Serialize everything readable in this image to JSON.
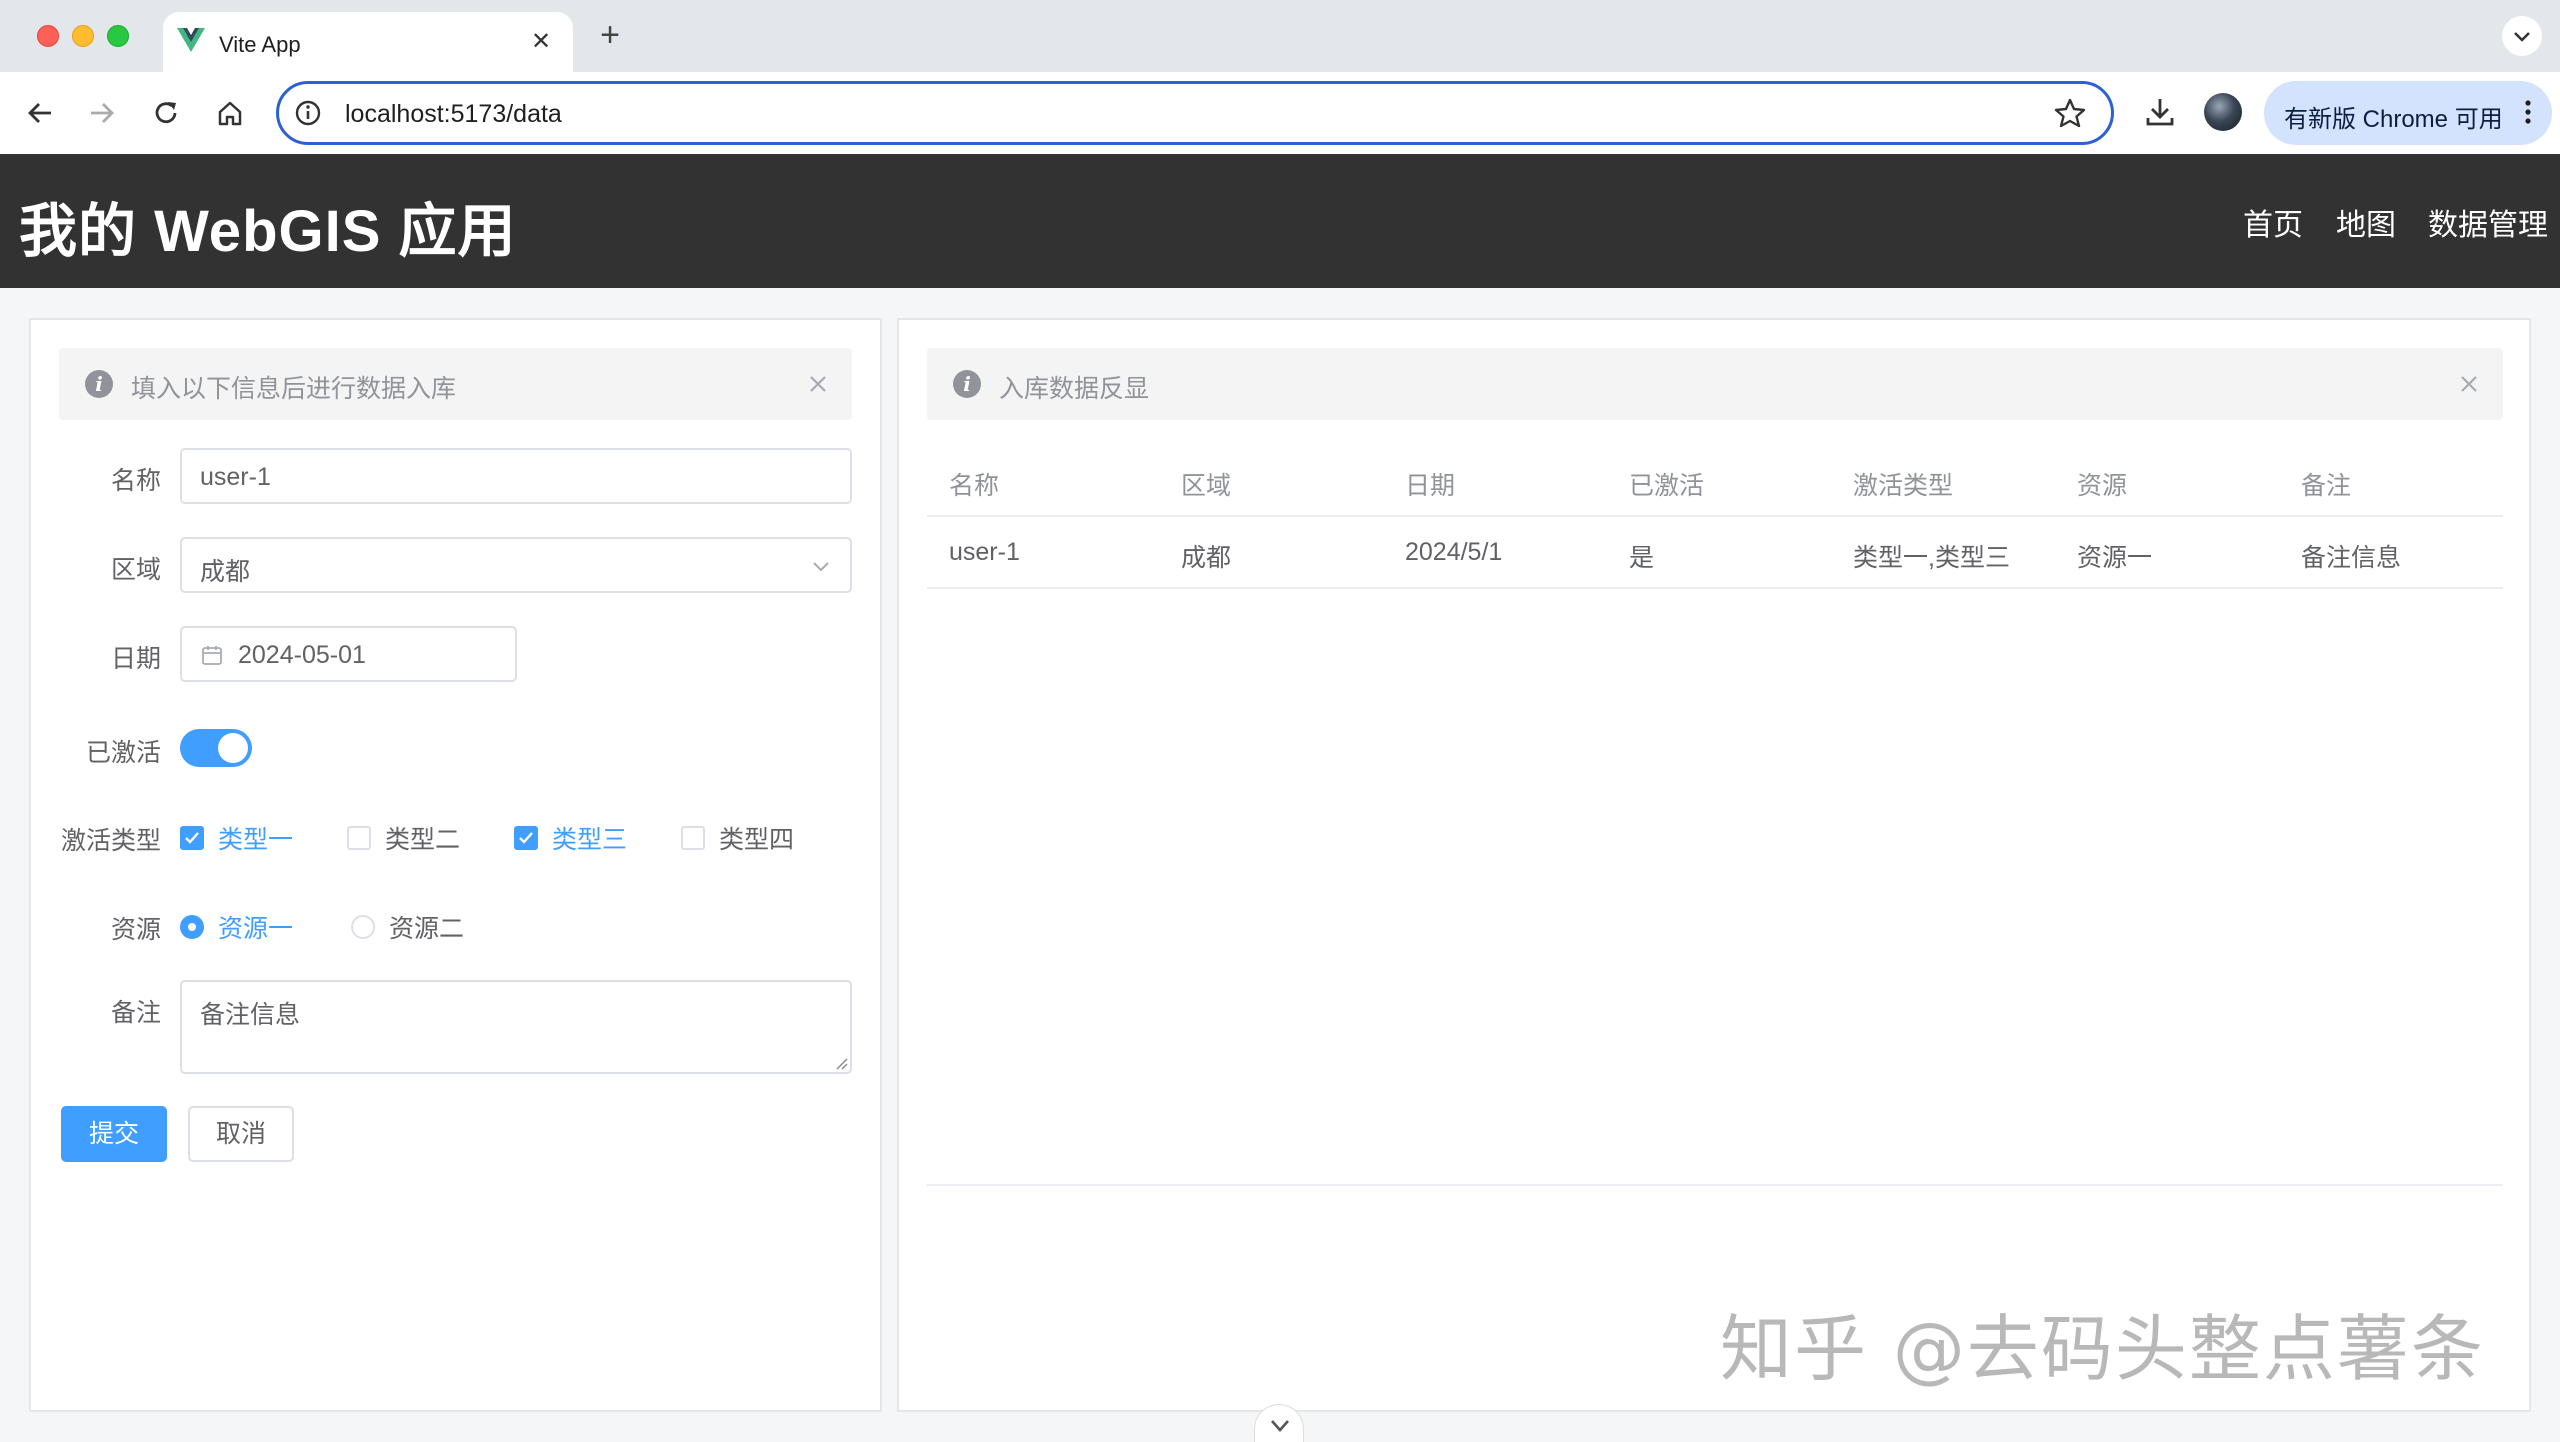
{
  "browser": {
    "tab_title": "Vite App",
    "url": "localhost:5173/data",
    "update_label": "有新版 Chrome 可用"
  },
  "header": {
    "title": "我的 WebGIS 应用",
    "nav": [
      "首页",
      "地图",
      "数据管理"
    ]
  },
  "form_panel": {
    "alert": "填入以下信息后进行数据入库",
    "fields": {
      "name": {
        "label": "名称",
        "value": "user-1"
      },
      "region": {
        "label": "区域",
        "value": "成都"
      },
      "date": {
        "label": "日期",
        "value": "2024-05-01"
      },
      "activated": {
        "label": "已激活",
        "checked": true
      },
      "types": {
        "label": "激活类型",
        "options": [
          {
            "label": "类型一",
            "checked": true
          },
          {
            "label": "类型二",
            "checked": false
          },
          {
            "label": "类型三",
            "checked": true
          },
          {
            "label": "类型四",
            "checked": false
          }
        ]
      },
      "resource": {
        "label": "资源",
        "options": [
          {
            "label": "资源一",
            "checked": true
          },
          {
            "label": "资源二",
            "checked": false
          }
        ]
      },
      "remark": {
        "label": "备注",
        "value": "备注信息"
      }
    },
    "submit_label": "提交",
    "cancel_label": "取消"
  },
  "table_panel": {
    "alert": "入库数据反显",
    "columns": [
      "名称",
      "区域",
      "日期",
      "已激活",
      "激活类型",
      "资源",
      "备注"
    ],
    "rows": [
      [
        "user-1",
        "成都",
        "2024/5/1",
        "是",
        "类型一,类型三",
        "资源一",
        "备注信息"
      ]
    ]
  },
  "watermark": "知乎 @去码头整点薯条",
  "colors": {
    "primary": "#409eff",
    "header_bg": "#323232",
    "omnibox_border": "#2d5fd6"
  }
}
